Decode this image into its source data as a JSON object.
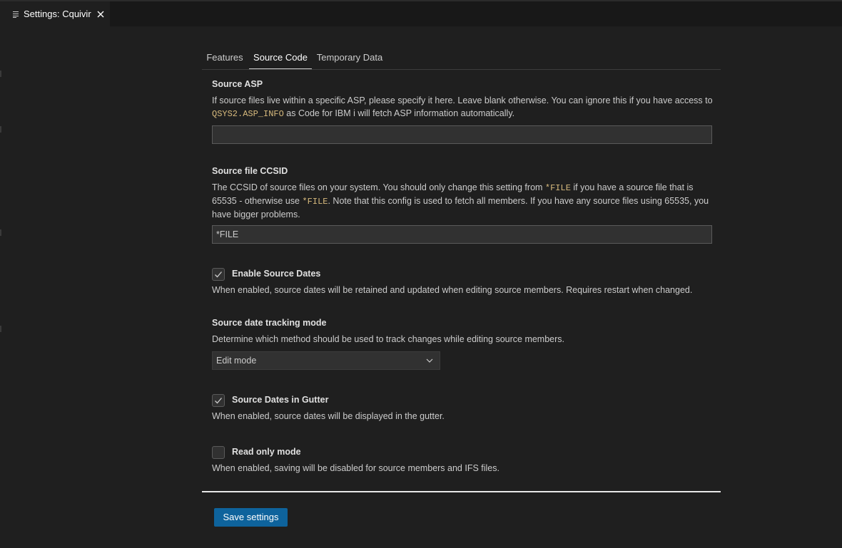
{
  "editor_tab": {
    "title": "Settings: Cquivir"
  },
  "tabs": [
    {
      "label": "Features",
      "active": false
    },
    {
      "label": "Source Code",
      "active": true
    },
    {
      "label": "Temporary Data",
      "active": false
    }
  ],
  "source_asp": {
    "label": "Source ASP",
    "desc_part1": "If source files live within a specific ASP, please specify it here. Leave blank otherwise. You can ignore this if you have access to ",
    "desc_code": "QSYS2.ASP_INFO",
    "desc_part2": " as Code for IBM i will fetch ASP information automatically.",
    "value": ""
  },
  "source_ccsid": {
    "label": "Source file CCSID",
    "desc_part1": "The CCSID of source files on your system. You should only change this setting from ",
    "desc_code1": "*FILE",
    "desc_part2": " if you have a source file that is 65535 - otherwise use ",
    "desc_code2": "*FILE",
    "desc_part3": ". Note that this config is used to fetch all members. If you have any source files using 65535, you have bigger problems.",
    "value": "*FILE"
  },
  "enable_source_dates": {
    "label": "Enable Source Dates",
    "checked": true,
    "desc": "When enabled, source dates will be retained and updated when editing source members. Requires restart when changed."
  },
  "tracking_mode": {
    "label": "Source date tracking mode",
    "desc": "Determine which method should be used to track changes while editing source members.",
    "selected": "Edit mode"
  },
  "dates_in_gutter": {
    "label": "Source Dates in Gutter",
    "checked": true,
    "desc": "When enabled, source dates will be displayed in the gutter."
  },
  "read_only": {
    "label": "Read only mode",
    "checked": false,
    "desc": "When enabled, saving will be disabled for source members and IFS files."
  },
  "save_button": {
    "label": "Save settings"
  },
  "colors": {
    "accent": "#0e639c",
    "code": "#d7ba7d",
    "background": "#1f1f1f"
  }
}
